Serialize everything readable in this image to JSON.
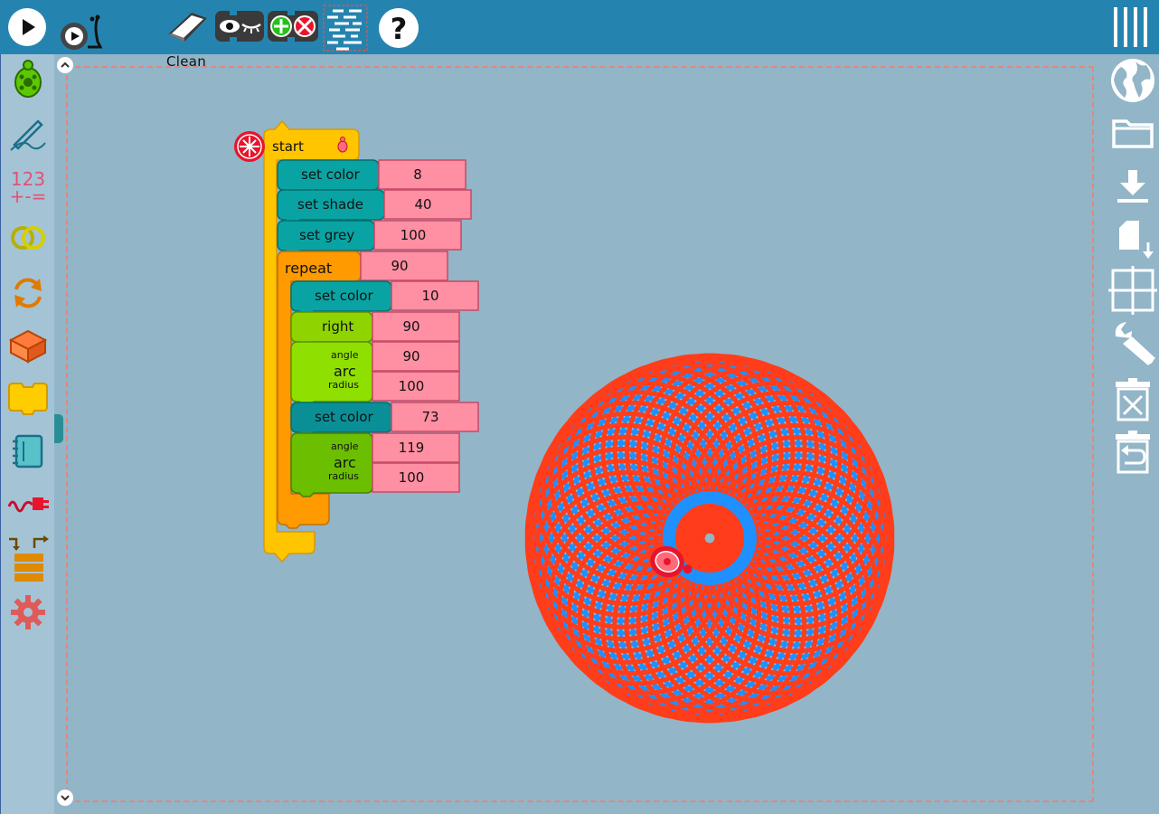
{
  "toolbar": {
    "clean_label": "Clean",
    "help_glyph": "?",
    "buttons": [
      "run-icon",
      "run-slow-icon",
      "clean-icon",
      "hide-blocks-icon",
      "collapse-expand-icon",
      "show-grid-icon",
      "help-icon",
      "menu-icon"
    ]
  },
  "palette": [
    "turtle-icon",
    "pen-icon",
    "number-icon",
    "boolean-icon",
    "flow-icon",
    "box-icon",
    "action-icon",
    "media-icon",
    "sensors-icon",
    "extras-icon",
    "settings-icon"
  ],
  "palette_number_text": "123",
  "palette_number_ops": "+-=",
  "aux": [
    "language-icon",
    "open-folder-icon",
    "save-icon",
    "save-as-icon",
    "cartesian-grid-icon",
    "wrench-icon",
    "trash-icon",
    "restore-icon"
  ],
  "program": {
    "start": "start",
    "blocks": [
      {
        "label": "set color",
        "value": "8"
      },
      {
        "label": "set shade",
        "value": "40"
      },
      {
        "label": "set grey",
        "value": "100"
      },
      {
        "label": "repeat",
        "value": "90"
      },
      {
        "label": "set color",
        "value": "10"
      },
      {
        "label": "right",
        "value": "90"
      },
      {
        "label": "arc",
        "arg1": "angle",
        "arg2": "radius",
        "value1": "90",
        "value2": "100"
      },
      {
        "label": "set color",
        "value": "73"
      },
      {
        "label": "arc",
        "arg1": "angle",
        "arg2": "radius",
        "value1": "119",
        "value2": "100"
      }
    ]
  },
  "colors": {
    "toolbar": "#2584af",
    "canvas": "#92b5c8",
    "pen_block": "#0aa3a3",
    "flow_block": "#ff9a00",
    "start_block": "#ffc500",
    "turtle_block": "#92d800",
    "number_value": "#ff8fa3",
    "drawing_red": "#ff3d1a",
    "drawing_blue": "#1e90ff"
  }
}
